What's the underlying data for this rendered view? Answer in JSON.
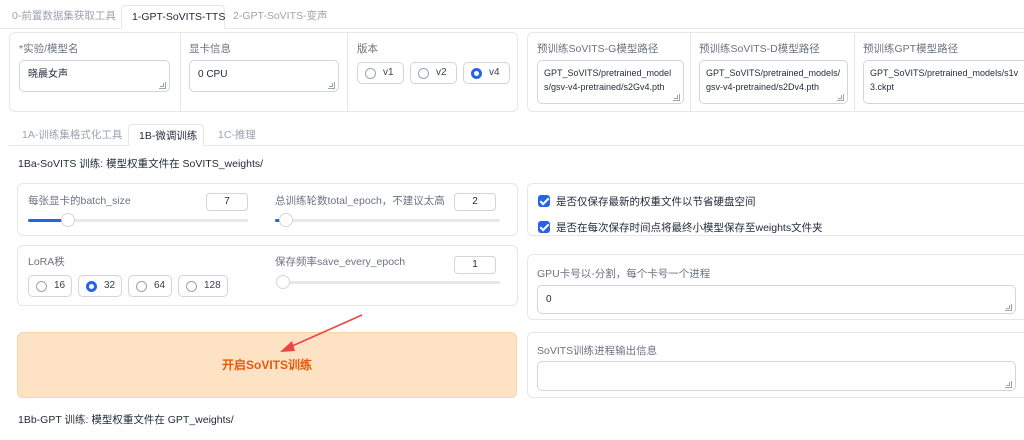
{
  "top_tabs": [
    {
      "label": "0-前置数据集获取工具",
      "active": false
    },
    {
      "label": "1-GPT-SoVITS-TTS",
      "active": true
    },
    {
      "label": "2-GPT-SoVITS-变声",
      "active": false
    }
  ],
  "config": {
    "model_name_label": "*实验/模型名",
    "model_name_value": "晓晨女声",
    "gpu_info_label": "显卡信息",
    "gpu_info_value": "0 CPU",
    "version_label": "版本",
    "versions": [
      "v1",
      "v2",
      "v4"
    ],
    "selected_version": "v4",
    "pretrained_sovits_g_label": "预训练SoVITS-G模型路径",
    "pretrained_sovits_g_value": "GPT_SoVITS/pretrained_models/gsv-v4-pretrained/s2Gv4.pth",
    "pretrained_sovits_d_label": "预训练SoVITS-D模型路径",
    "pretrained_sovits_d_value": "GPT_SoVITS/pretrained_models/gsv-v4-pretrained/s2Dv4.pth",
    "pretrained_gpt_label": "预训练GPT模型路径",
    "pretrained_gpt_value": "GPT_SoVITS/pretrained_models/s1v3.ckpt"
  },
  "sub_tabs": [
    {
      "label": "1A-训练集格式化工具",
      "active": false
    },
    {
      "label": "1B-微调训练",
      "active": true
    },
    {
      "label": "1C-推理",
      "active": false
    }
  ],
  "sovits_section_title": "1Ba-SoVITS 训练: 模型权重文件在 SoVITS_weights/",
  "batch_size": {
    "label": "每张显卡的batch_size",
    "value": "7",
    "fraction": 0.18
  },
  "total_epoch": {
    "label": "总训练轮数total_epoch，不建议太高",
    "value": "2",
    "fraction": 0.05
  },
  "lora_rank": {
    "label": "LoRA秩",
    "options": [
      "16",
      "32",
      "64",
      "128"
    ],
    "selected": "32"
  },
  "save_every_epoch": {
    "label": "保存频率save_every_epoch",
    "value": "1",
    "fraction": 0.0
  },
  "checkboxes": [
    {
      "label": "是否仅保存最新的权重文件以节省硬盘空间",
      "checked": true
    },
    {
      "label": "是否在每次保存时间点将最终小模型保存至weights文件夹",
      "checked": true
    }
  ],
  "gpu_ids": {
    "label": "GPU卡号以-分割，每个卡号一个进程",
    "value": "0"
  },
  "train_button_label": "开启SoVITS训练",
  "sovits_output_label": "SoVITS训练进程输出信息",
  "gpt_section_title": "1Bb-GPT 训练: 模型权重文件在 GPT_weights/",
  "colors": {
    "accent": "#2563eb",
    "button_bg": "#fde3c4",
    "button_text": "#ea580c",
    "annotation_arrow": "#ef4444"
  }
}
